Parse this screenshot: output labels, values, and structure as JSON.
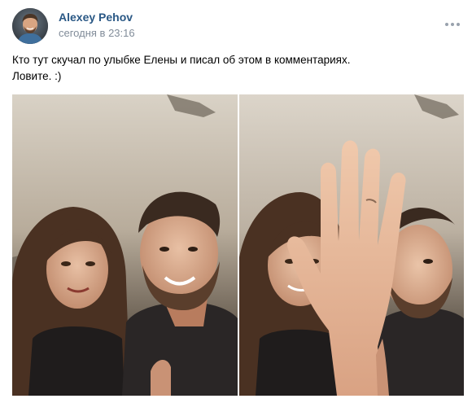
{
  "post": {
    "author_name": "Alexey Pehov",
    "timestamp": "сегодня в 23:16",
    "text_line_1": "Кто тут скучал по улыбке Елены и писал об этом в комментариях.",
    "text_line_2": "Ловите. :)"
  },
  "icons": {
    "more": "more-horizontal-icon",
    "avatar": "user-avatar-photo"
  },
  "colors": {
    "author": "#2a5885",
    "meta": "#818c99",
    "text": "#000000",
    "icon": "#99a2ad"
  }
}
